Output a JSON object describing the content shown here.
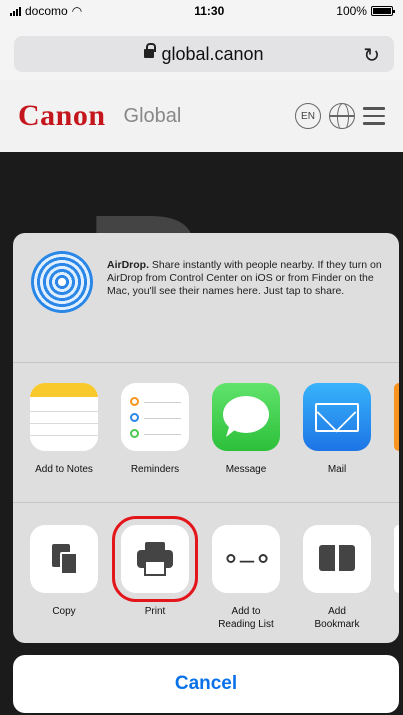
{
  "status_bar": {
    "carrier": "docomo",
    "time": "11:30",
    "battery": "100%"
  },
  "url_bar": {
    "domain": "global.canon"
  },
  "site_header": {
    "logo": "Canon",
    "title": "Global",
    "language": "EN"
  },
  "share_sheet": {
    "airdrop": {
      "title": "AirDrop.",
      "description": " Share instantly with people nearby. If they turn on AirDrop from Control Center on iOS or from Finder on the Mac, you'll see their names here. Just tap to share."
    },
    "apps": [
      {
        "label": "Add to Notes",
        "icon": "notes-icon"
      },
      {
        "label": "Reminders",
        "icon": "reminders-icon"
      },
      {
        "label": "Message",
        "icon": "message-icon"
      },
      {
        "label": "Mail",
        "icon": "mail-icon"
      }
    ],
    "actions": [
      {
        "label": "Copy",
        "icon": "copy-icon"
      },
      {
        "label": "Print",
        "icon": "print-icon",
        "highlighted": true
      },
      {
        "label": "Add to\nReading List",
        "icon": "glasses-icon"
      },
      {
        "label": "Add\nBookmark",
        "icon": "book-icon"
      }
    ]
  },
  "cancel_label": "Cancel",
  "colors": {
    "canon_red": "#c4161c",
    "ios_blue": "#0a72e8",
    "highlight_red": "#e3161b"
  }
}
